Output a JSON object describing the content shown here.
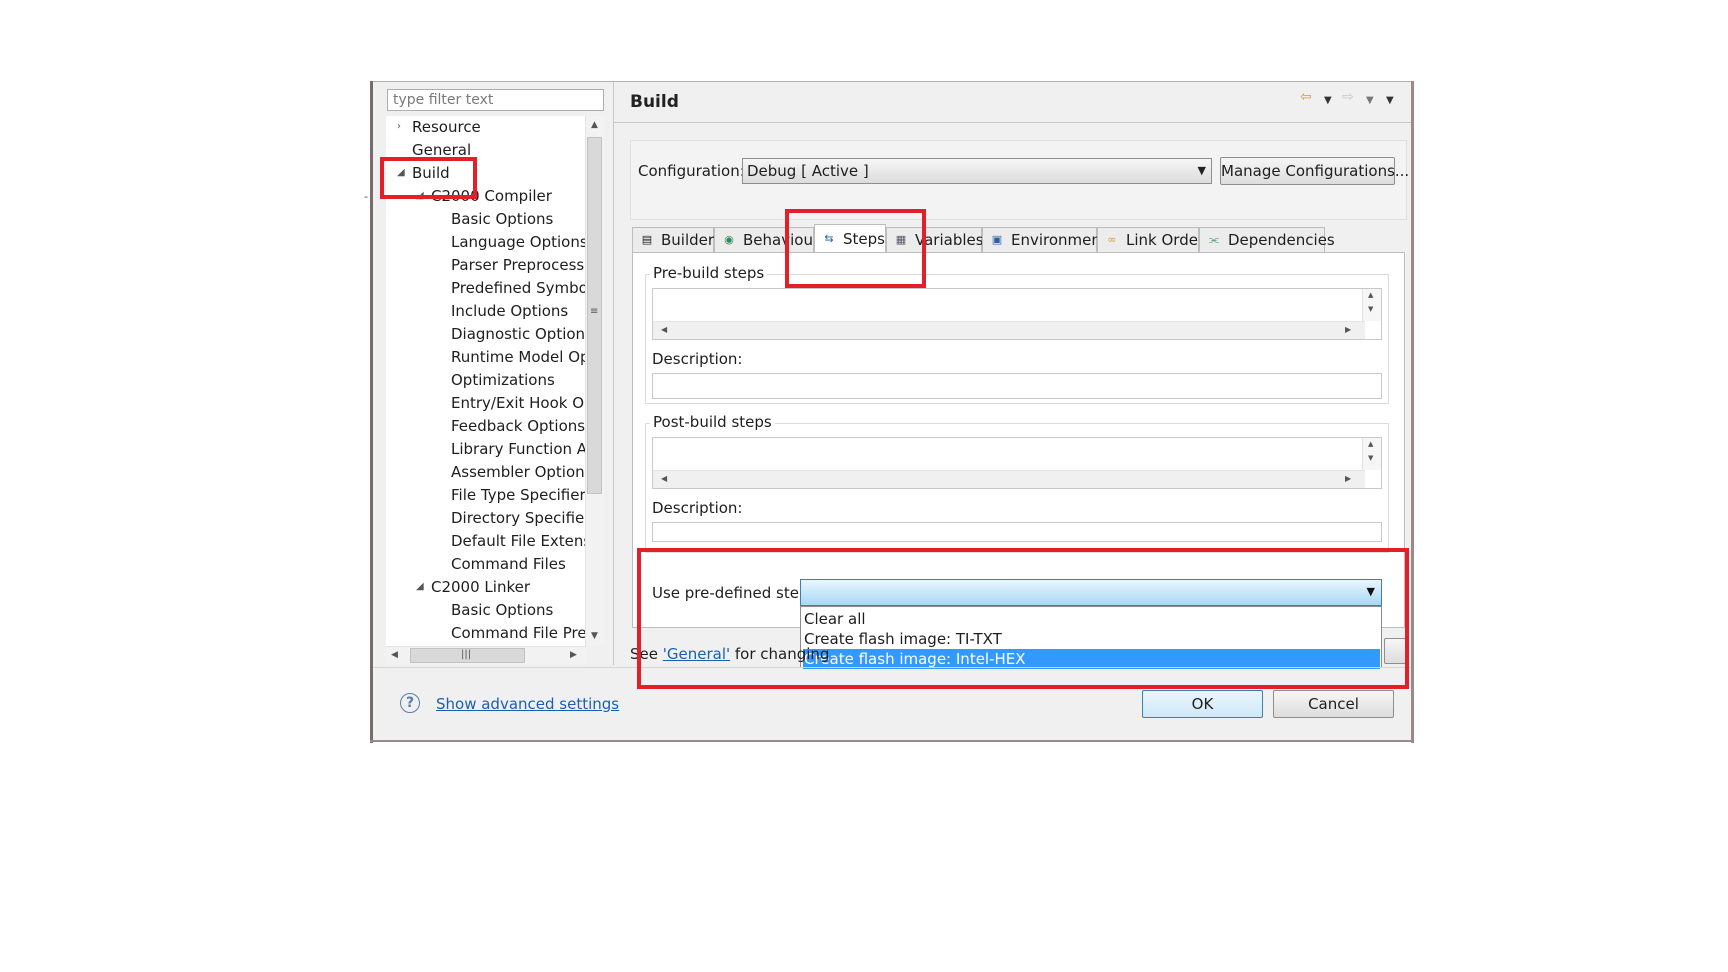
{
  "filter": {
    "placeholder": "type filter text"
  },
  "tree": {
    "items": [
      {
        "label": "Resource",
        "level": 0,
        "twisty": "collapsed"
      },
      {
        "label": "General",
        "level": 0
      },
      {
        "label": "Build",
        "level": 0,
        "twisty": "expanded"
      },
      {
        "label": "C2000 Compiler",
        "level": 1,
        "twisty": "expanded"
      },
      {
        "label": "Basic Options",
        "level": 2
      },
      {
        "label": "Language Options",
        "level": 2
      },
      {
        "label": "Parser Preprocessing",
        "level": 2
      },
      {
        "label": "Predefined Symbols",
        "level": 2
      },
      {
        "label": "Include Options",
        "level": 2
      },
      {
        "label": "Diagnostic Options",
        "level": 2
      },
      {
        "label": "Runtime Model Opti",
        "level": 2
      },
      {
        "label": "Optimizations",
        "level": 2
      },
      {
        "label": "Entry/Exit Hook Opt",
        "level": 2
      },
      {
        "label": "Feedback Options",
        "level": 2
      },
      {
        "label": "Library Function Ass",
        "level": 2
      },
      {
        "label": "Assembler Options",
        "level": 2
      },
      {
        "label": "File Type Specifier",
        "level": 2
      },
      {
        "label": "Directory Specifier",
        "level": 2
      },
      {
        "label": "Default File Extensic",
        "level": 2
      },
      {
        "label": "Command Files",
        "level": 2
      },
      {
        "label": "C2000 Linker",
        "level": 1,
        "twisty": "expanded"
      },
      {
        "label": "Basic Options",
        "level": 2
      },
      {
        "label": "Command File Prepr",
        "level": 2
      }
    ]
  },
  "page": {
    "title": "Build"
  },
  "config": {
    "label": "Configuration:",
    "value": "Debug  [ Active ]",
    "manage_button": "Manage Configurations..."
  },
  "tabs": [
    {
      "label": "Builder",
      "icon": "builder-icon"
    },
    {
      "label": "Behaviour",
      "icon": "behaviour-icon"
    },
    {
      "label": "Steps",
      "icon": "steps-icon",
      "active": true
    },
    {
      "label": "Variables",
      "icon": "variables-icon"
    },
    {
      "label": "Environment",
      "icon": "environment-icon"
    },
    {
      "label": "Link Order",
      "icon": "link-order-icon"
    },
    {
      "label": "Dependencies",
      "icon": "dependencies-icon"
    }
  ],
  "steps": {
    "pre_build": {
      "title": "Pre-build steps",
      "description_label": "Description:"
    },
    "post_build": {
      "title": "Post-build steps",
      "description_label": "Description:"
    },
    "predefined": {
      "label": "Use pre-defined step:",
      "options": [
        "Clear all",
        "Create flash image: TI-TXT",
        "Create flash image: Intel-HEX"
      ],
      "highlighted": "Create flash image: Intel-HEX"
    }
  },
  "footer_note": {
    "prefix": "See ",
    "link": "'General'",
    "suffix": " for changing"
  },
  "bottom": {
    "advanced_link": "Show advanced settings",
    "ok": "OK",
    "cancel": "Cancel"
  },
  "colors": {
    "highlight_box": "#e3202a",
    "selection": "#3399ff",
    "link": "#1a5fb4"
  }
}
